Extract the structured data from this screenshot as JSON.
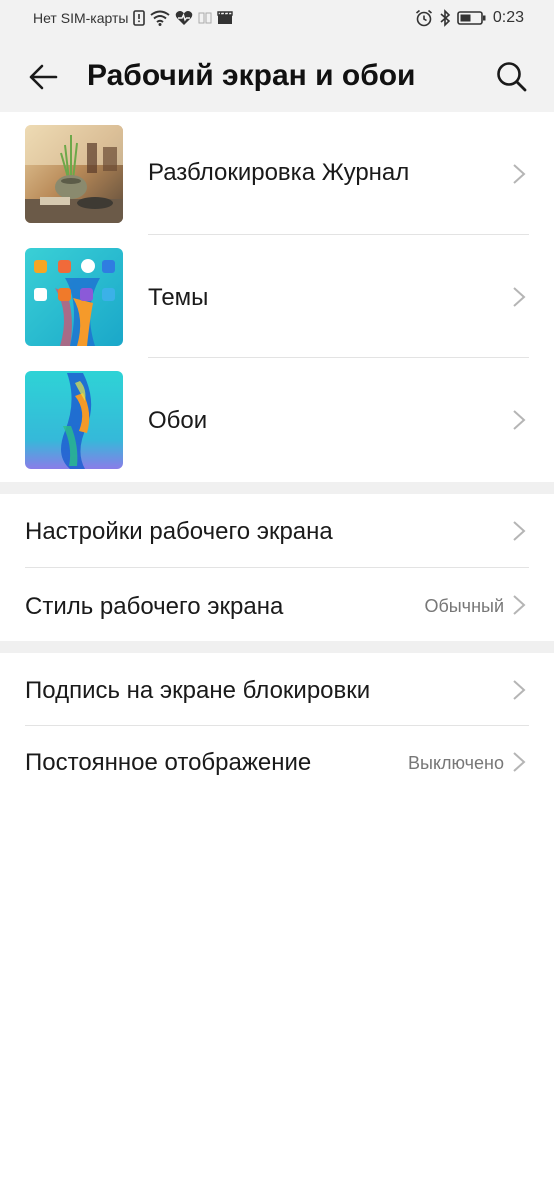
{
  "status_bar": {
    "carrier": "Нет SIM-карты",
    "time": "0:23"
  },
  "header": {
    "title": "Рабочий экран и обои",
    "back_icon": "back-arrow-icon",
    "search_icon": "search-icon"
  },
  "media_items": [
    {
      "label": "Разблокировка Журнал",
      "thumb": "unlock-magazine-thumbnail"
    },
    {
      "label": "Темы",
      "thumb": "themes-thumbnail"
    },
    {
      "label": "Обои",
      "thumb": "wallpaper-thumbnail"
    }
  ],
  "settings_group_1": [
    {
      "label": "Настройки рабочего экрана",
      "value": ""
    },
    {
      "label": "Стиль рабочего экрана",
      "value": "Обычный"
    }
  ],
  "settings_group_2": [
    {
      "label": "Подпись на экране блокировки",
      "value": ""
    },
    {
      "label": "Постоянное отображение",
      "value": "Выключено"
    }
  ],
  "colors": {
    "header_bg": "#f2f2f2",
    "separator": "#f0f0f0",
    "text": "#1a1a1a",
    "secondary_text": "#777777",
    "chevron": "#b5b5b5"
  }
}
